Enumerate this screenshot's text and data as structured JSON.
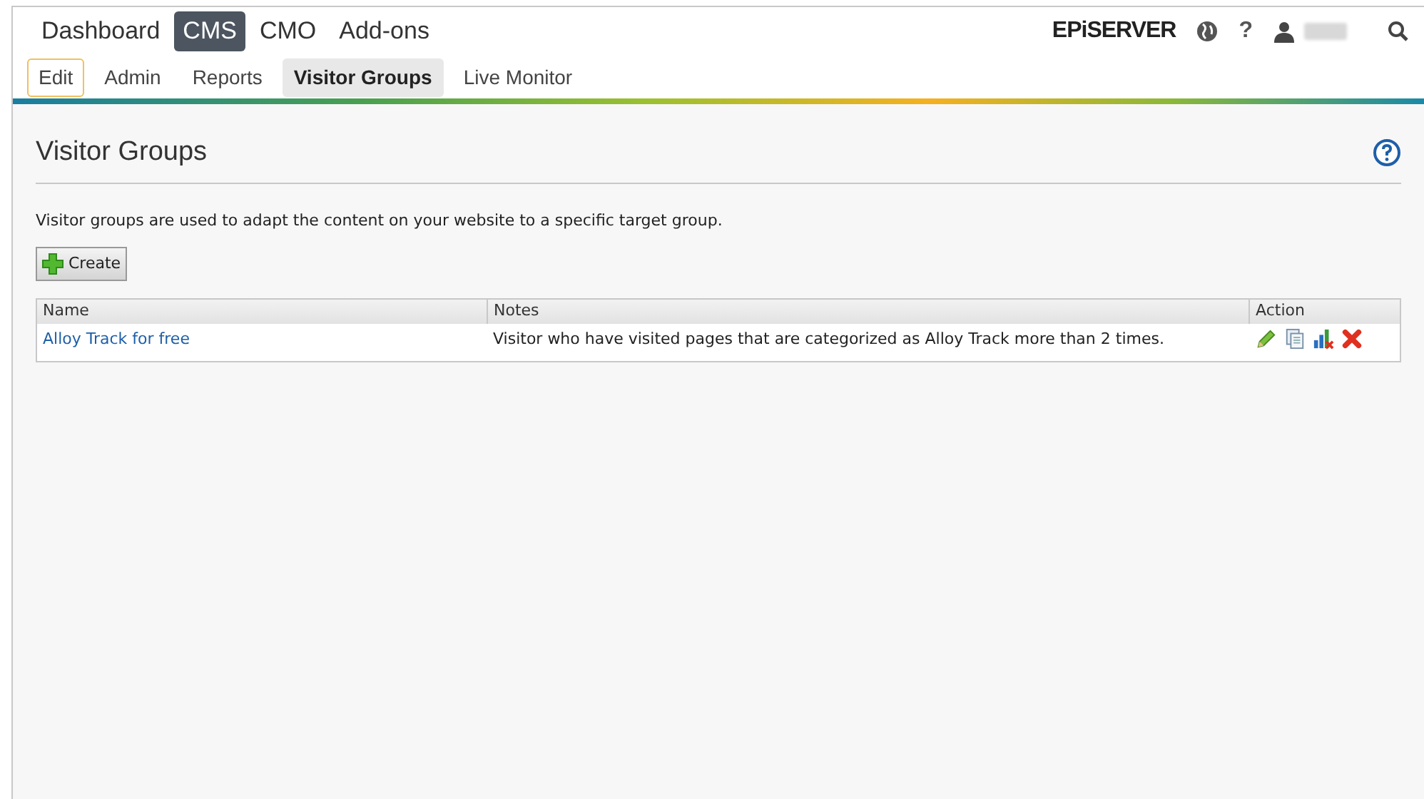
{
  "top_nav": [
    {
      "label": "Dashboard",
      "selected": false
    },
    {
      "label": "CMS",
      "selected": true
    },
    {
      "label": "CMO",
      "selected": false
    },
    {
      "label": "Add-ons",
      "selected": false
    }
  ],
  "logo": "EPiSERVER",
  "help_label": "?",
  "sub_nav": [
    {
      "label": "Edit",
      "selected": false,
      "outlined": true
    },
    {
      "label": "Admin",
      "selected": false,
      "outlined": false
    },
    {
      "label": "Reports",
      "selected": false,
      "outlined": false
    },
    {
      "label": "Visitor Groups",
      "selected": true,
      "outlined": false
    },
    {
      "label": "Live Monitor",
      "selected": false,
      "outlined": false
    }
  ],
  "page": {
    "title": "Visitor Groups",
    "description": "Visitor groups are used to adapt the content on your website to a specific target group.",
    "create_button": "Create"
  },
  "table": {
    "columns": [
      "Name",
      "Notes",
      "Action"
    ],
    "rows": [
      {
        "name": "Alloy Track for free",
        "notes": "Visitor who have visited pages that are categorized as Alloy Track more than 2 times."
      }
    ]
  }
}
